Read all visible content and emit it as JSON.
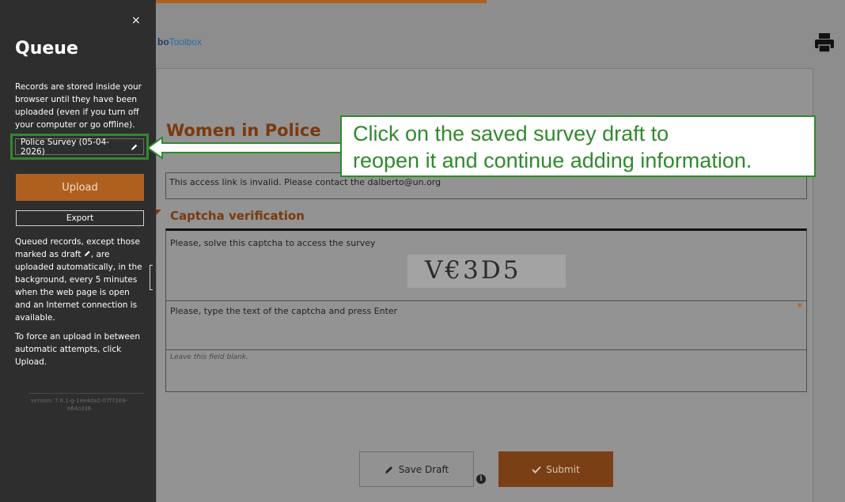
{
  "colors": {
    "accent": "#b0601e",
    "highlight_green": "#2f8a2c",
    "title_brown": "#7a3a0e"
  },
  "header": {
    "brand_part1": "bo",
    "brand_part2": "Toolbox",
    "print_icon": "printer-icon"
  },
  "form": {
    "title": "Women in Police",
    "notice": "This access link is invalid. Please contact the dalberto@un.org",
    "group_title": "Captcha verification",
    "q1_label": "Please, solve this captcha to access the survey",
    "captcha_text": "V€3D5",
    "q2_label": "Please, type the text of the captcha and press Enter",
    "required_mark": "*",
    "q3_label": "Leave this field blank.",
    "save_draft_label": "Save Draft",
    "submit_label": "Submit",
    "info_icon": "i"
  },
  "sidebar": {
    "close_label": "×",
    "title": "Queue",
    "description": "Records are stored inside your browser until they have been uploaded (even if you turn off your computer or go offline).",
    "record_label": "Police Survey (05-04-2026)",
    "upload_label": "Upload",
    "export_label": "Export",
    "queued_desc_pre": "Queued records, except those marked as draft ",
    "queued_desc_post": ", are uploaded automatically, in the background, every 5 minutes when the web page is open and an Internet connection is available.",
    "force_desc": "To force an upload in between automatic attempts, click Upload.",
    "version": "version: 7.6.1-g-1ee4da2-07f7269-e64cd36"
  },
  "callout": {
    "line1": "Click on the saved survey draft to",
    "line2": "reopen it and continue adding information."
  }
}
